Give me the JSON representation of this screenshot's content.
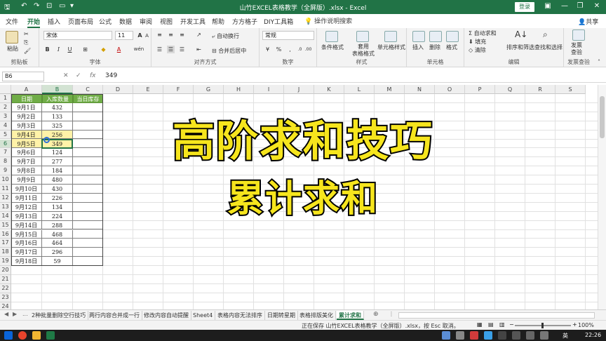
{
  "titlebar": {
    "title": "山竹EXCEL表格教学（全屏版）.xlsx - Excel",
    "login": "登录",
    "autosave_icon": "save-icon",
    "undo_icon": "undo-icon",
    "redo_icon": "redo-icon",
    "minimize": "—",
    "restore": "❐",
    "close": "✕",
    "ribbon_options": "▣",
    "accent": "#217346"
  },
  "tabs": {
    "items": [
      "文件",
      "开始",
      "插入",
      "页面布局",
      "公式",
      "数据",
      "审阅",
      "视图",
      "开发工具",
      "帮助",
      "方方格子",
      "DIY工具箱"
    ],
    "active": "开始",
    "search": "操作说明搜索",
    "share": "共享"
  },
  "ribbon": {
    "clipboard": {
      "paste": "粘贴",
      "label": "剪贴板"
    },
    "font": {
      "name": "宋体",
      "size": "11",
      "bold": "B",
      "italic": "I",
      "underline": "U",
      "grow": "A",
      "shrink": "A",
      "wen": "wén",
      "label": "字体"
    },
    "alignment": {
      "wrap": "自动换行",
      "merge": "合并后居中",
      "label": "对齐方式"
    },
    "number": {
      "format": "常规",
      "label": "数字"
    },
    "styles": {
      "conditional": "条件格式",
      "table": "套用\n表格格式",
      "cell_styles": "单元格样式",
      "label": "样式"
    },
    "cells": {
      "insert": "插入",
      "delete": "删除",
      "format": "格式",
      "label": "单元格"
    },
    "editing": {
      "autosum": "自动求和",
      "fill": "填充",
      "clear": "清除",
      "sort": "排序和筛选",
      "find": "查找和选择",
      "label": "编辑"
    },
    "invoice": {
      "check": "发票\n查验",
      "label": "发票查验"
    }
  },
  "formula_bar": {
    "name_box": "B6",
    "cancel": "✕",
    "enter": "✓",
    "fx": "fx",
    "value": "349"
  },
  "grid": {
    "columns": [
      "A",
      "B",
      "C",
      "D",
      "E",
      "F",
      "G",
      "H",
      "I",
      "J",
      "K",
      "L",
      "M",
      "N",
      "O",
      "P",
      "Q",
      "R",
      "S"
    ],
    "rows": [
      "1",
      "2",
      "3",
      "4",
      "5",
      "6",
      "7",
      "8",
      "9",
      "10",
      "11",
      "12",
      "13",
      "14",
      "15",
      "16",
      "17",
      "18",
      "19",
      "20",
      "21",
      "22",
      "23",
      "24"
    ],
    "selected_col": "B",
    "selected_row": "6",
    "header_color": "#70ad47",
    "headers": [
      "日期",
      "入库数量",
      "当日库存"
    ],
    "data": [
      [
        "9月1日",
        "432",
        ""
      ],
      [
        "9月2日",
        "133",
        ""
      ],
      [
        "9月3日",
        "325",
        ""
      ],
      [
        "9月4日",
        "256",
        ""
      ],
      [
        "9月5日",
        "349",
        ""
      ],
      [
        "9月6日",
        "124",
        ""
      ],
      [
        "9月7日",
        "277",
        ""
      ],
      [
        "9月8日",
        "184",
        ""
      ],
      [
        "9月9日",
        "480",
        ""
      ],
      [
        "9月10日",
        "430",
        ""
      ],
      [
        "9月11日",
        "226",
        ""
      ],
      [
        "9月12日",
        "134",
        ""
      ],
      [
        "9月13日",
        "224",
        ""
      ],
      [
        "9月14日",
        "288",
        ""
      ],
      [
        "9月15日",
        "468",
        ""
      ],
      [
        "9月16日",
        "464",
        ""
      ],
      [
        "9月17日",
        "296",
        ""
      ],
      [
        "9月18日",
        "59",
        ""
      ]
    ]
  },
  "overlay": {
    "line1": "高阶求和技巧",
    "line2": "累计求和",
    "color": "#f6e51d"
  },
  "sheets": {
    "nav_prev": "◀",
    "nav_next": "▶",
    "more": "...",
    "items": [
      "2种批量删除空行技巧",
      "两行内容合并成一行",
      "修改内容自动提醒",
      "Sheet4",
      "表格内容无法排序",
      "日期转星期",
      "表格排版美化",
      "累计求和"
    ],
    "active": "累计求和",
    "add": "⊕"
  },
  "status": {
    "text": "正在保存 山竹EXCEL表格教学（全屏版）.xlsx，按 Esc 取消。",
    "zoom": "100%",
    "zoom_minus": "−",
    "zoom_plus": "+"
  },
  "taskbar": {
    "ime": "英",
    "clock": "22:26"
  }
}
